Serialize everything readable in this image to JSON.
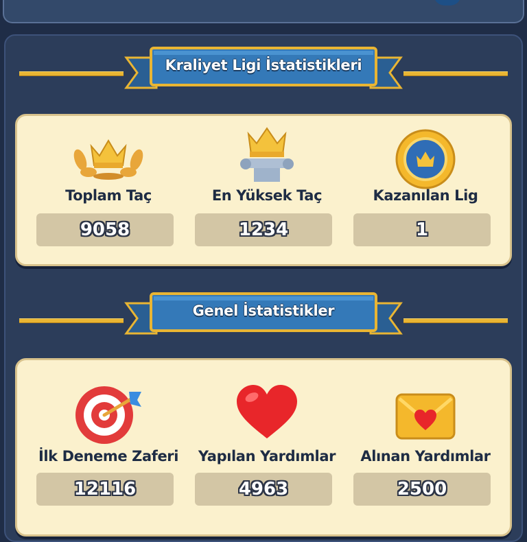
{
  "royal_league": {
    "title": "Kraliyet Ligi İstatistikleri",
    "stats": [
      {
        "label": "Toplam Taç",
        "value": "9058",
        "icon": "crown-laurel-icon"
      },
      {
        "label": "En Yüksek Taç",
        "value": "1234",
        "icon": "crown-pedestal-icon"
      },
      {
        "label": "Kazanılan Lig",
        "value": "1",
        "icon": "league-medal-icon"
      }
    ]
  },
  "general": {
    "title": "Genel İstatistikler",
    "stats": [
      {
        "label": "İlk Deneme Zaferi",
        "value": "12116",
        "icon": "target-arrow-icon"
      },
      {
        "label": "Yapılan Yardımlar",
        "value": "4963",
        "icon": "heart-icon"
      },
      {
        "label": "Alınan Yardımlar",
        "value": "2500",
        "icon": "heart-envelope-icon"
      }
    ]
  },
  "colors": {
    "background": "#1f2d47",
    "card": "#fbf1cd",
    "banner_blue": "#2f6da6",
    "gold": "#e9b533",
    "value_box": "#d3c6a5"
  }
}
